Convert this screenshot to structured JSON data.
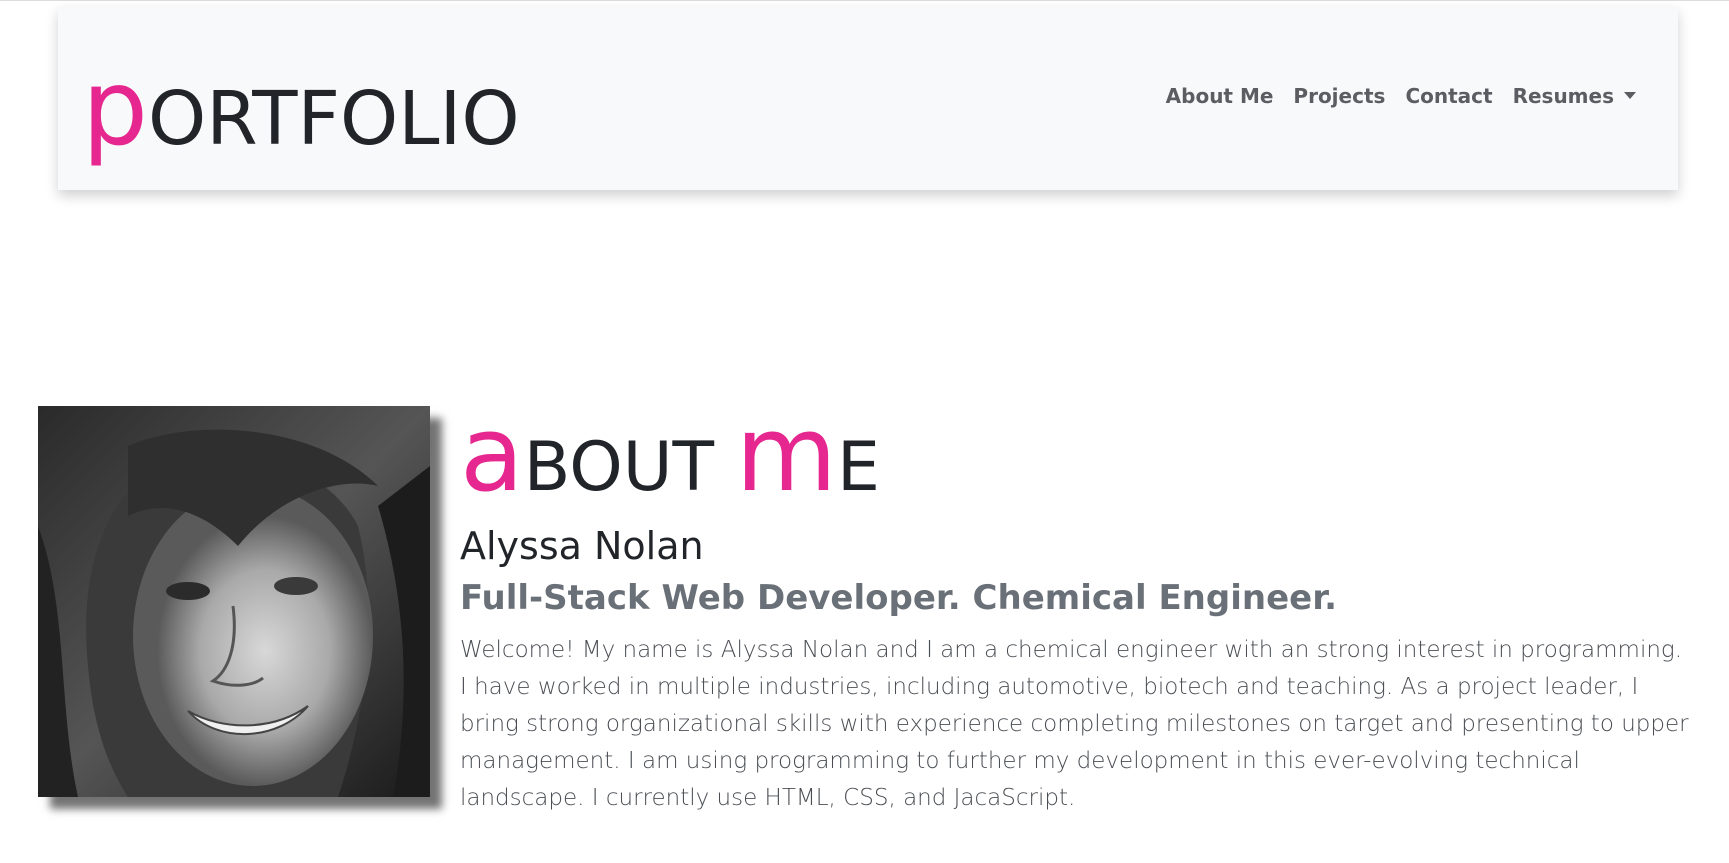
{
  "brand": {
    "first_letter": "p",
    "rest": "ORTFOLIO"
  },
  "nav": {
    "items": [
      {
        "label": "About Me"
      },
      {
        "label": "Projects"
      },
      {
        "label": "Contact"
      },
      {
        "label": "Resumes"
      }
    ]
  },
  "about": {
    "heading_a": "a",
    "heading_bout": "BOUT ",
    "heading_m": "m",
    "heading_e": "E",
    "name": "Alyssa Nolan",
    "tagline": "Full-Stack Web Developer. Chemical Engineer.",
    "bio": "Welcome! My name is Alyssa Nolan and I am a chemical engineer with an strong interest in programming. I have worked in multiple industries, including automotive, biotech and teaching. As a project leader, I bring strong organizational skills with experience completing milestones on target and presenting to upper management. I am using programming to further my development in this ever-evolving technical landscape. I currently use HTML, CSS, and JacaScript."
  },
  "colors": {
    "accent": "#e6278f",
    "text_dark": "#212529",
    "nav_bg": "#f8f9fa",
    "tagline": "#6a7077"
  },
  "icons": {
    "dropdown": "caret-down-icon"
  }
}
